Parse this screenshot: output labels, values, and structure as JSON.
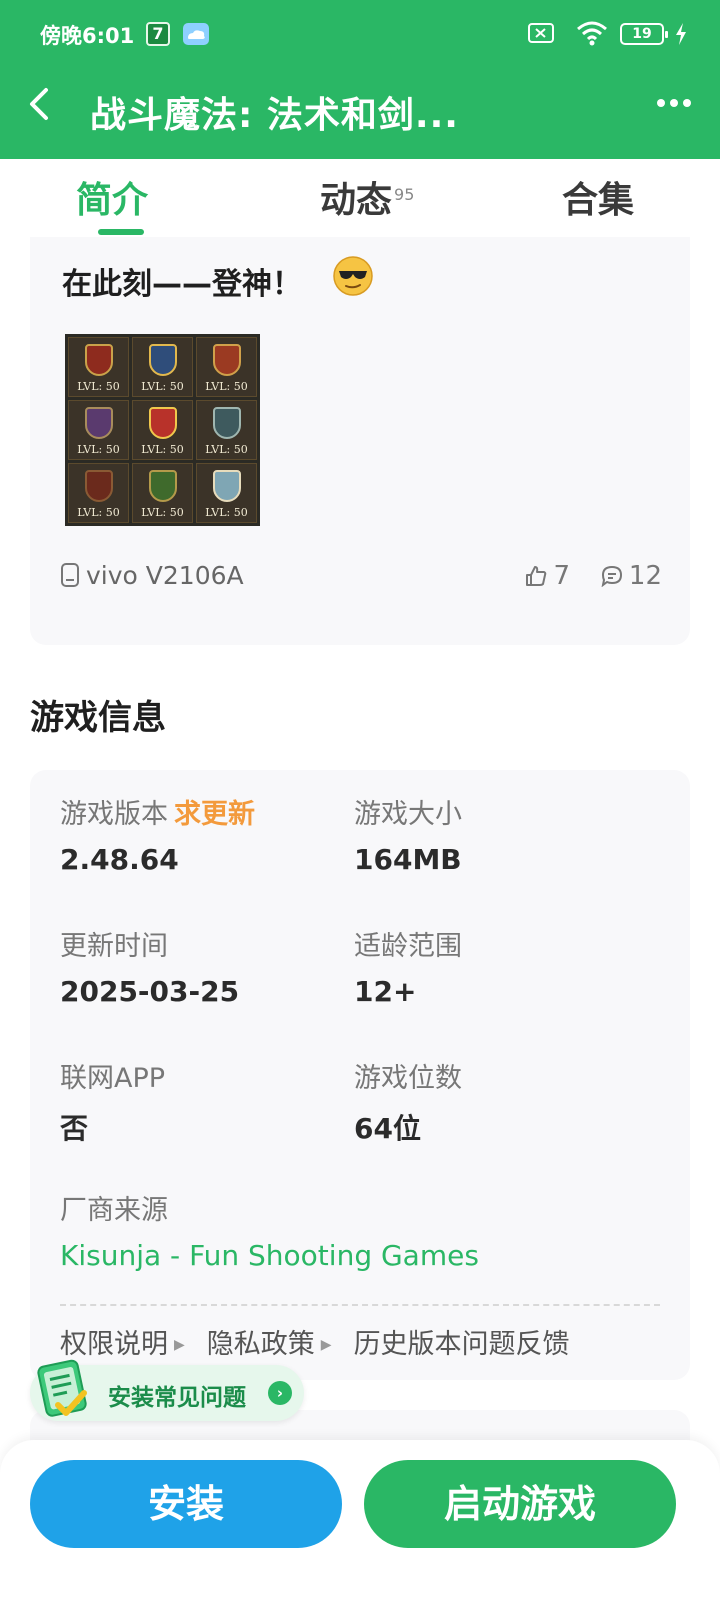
{
  "status_bar": {
    "time": "傍晚6:01",
    "notif_badge": "7",
    "battery": "19"
  },
  "nav": {
    "title": "战斗魔法: 法术和剑..."
  },
  "tabs": [
    {
      "label": "简介"
    },
    {
      "label": "动态",
      "count": "95"
    },
    {
      "label": "合集"
    }
  ],
  "post": {
    "text": "在此刻——登神！",
    "image_badges": [
      "LVL: 50",
      "LVL: 50",
      "LVL: 50",
      "LVL: 50",
      "LVL: 50",
      "LVL: 50",
      "LVL: 50",
      "LVL: 50",
      "LVL: 50"
    ],
    "device": "vivo V2106A",
    "likes": "7",
    "comments": "12"
  },
  "game_info": {
    "section_title": "游戏信息",
    "version_label": "游戏版本",
    "version_update_link": "求更新",
    "version_value": "2.48.64",
    "size_label": "游戏大小",
    "size_value": "164MB",
    "update_time_label": "更新时间",
    "update_time_value": "2025-03-25",
    "age_label": "适龄范围",
    "age_value": "12+",
    "online_label": "联网APP",
    "online_value": "否",
    "bits_label": "游戏位数",
    "bits_value": "64位",
    "vendor_label": "厂商来源",
    "vendor_value": "Kisunja - Fun Shooting Games",
    "links": [
      "权限说明",
      "隐私政策",
      "历史版本",
      "问题反馈"
    ]
  },
  "faq": {
    "label": "安装常见问题"
  },
  "actions": {
    "install": "安装",
    "launch": "启动游戏"
  },
  "colors": {
    "brand_green": "#2ab765",
    "install_blue": "#1fa2e8",
    "update_orange": "#f39a3c"
  }
}
